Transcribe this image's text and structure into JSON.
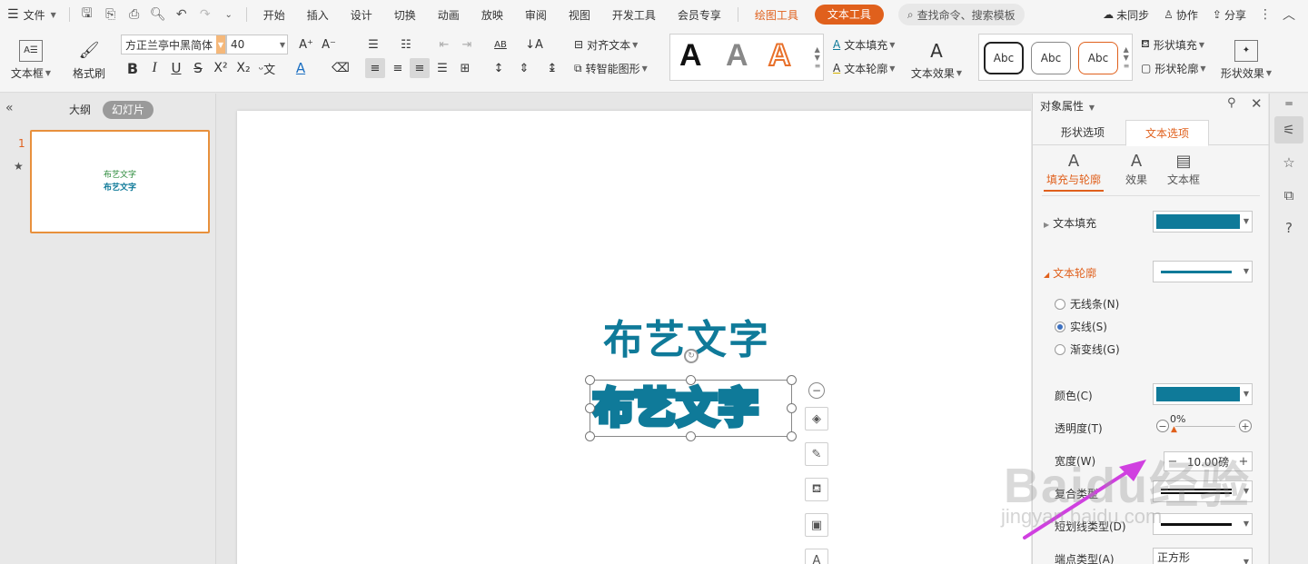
{
  "menubar": {
    "file_label": "文件",
    "tabs": [
      "开始",
      "插入",
      "设计",
      "切换",
      "动画",
      "放映",
      "审阅",
      "视图",
      "开发工具",
      "会员专享"
    ],
    "draw_tools": "绘图工具",
    "text_tools": "文本工具",
    "search": "查找命令、搜索模板",
    "unsynced": "未同步",
    "collab": "协作",
    "share": "分享"
  },
  "ribbon": {
    "textbox": "文本框",
    "format_painter": "格式刷",
    "font_name": "方正兰亭中黑简体",
    "font_size": "40",
    "align_text": "对齐文本",
    "smart_shape": "转智能图形",
    "text_fill": "文本填充",
    "text_outline": "文本轮廓",
    "text_effect": "文本效果",
    "style_letter": "A",
    "abc_label": "Abc",
    "shape_fill": "形状填充",
    "shape_outline": "形状轮廓",
    "shape_effect": "形状效果"
  },
  "leftpane": {
    "outline_tab": "大纲",
    "slides_tab": "幻灯片",
    "slide_number": "1",
    "thumb_line1": "布艺文字",
    "thumb_line2": "布艺文字"
  },
  "canvas": {
    "title_text": "布艺文字",
    "fabric_text": "布艺文字"
  },
  "rightpanel": {
    "title": "对象属性",
    "tab_shape": "形状选项",
    "tab_text": "文本选项",
    "sub_fill": "填充与轮廓",
    "sub_effect": "效果",
    "sub_textbox": "文本框",
    "text_fill": "文本填充",
    "text_outline": "文本轮廓",
    "no_line": "无线条(N)",
    "solid_line": "实线(S)",
    "gradient_line": "渐变线(G)",
    "color": "颜色(C)",
    "transparency": "透明度(T)",
    "transparency_value": "0%",
    "width": "宽度(W)",
    "width_value": "10.00磅",
    "compound": "复合类型",
    "dash": "短划线类型(D)",
    "cap": "端点类型(A)",
    "cap_value": "正方形"
  },
  "colors": {
    "accent": "#e0601c",
    "text_teal": "#0f7a99",
    "fill_swatch": "#0f7a99"
  },
  "watermark": {
    "main": "Baidu经验",
    "sub": "jingyan.baidu.com"
  }
}
